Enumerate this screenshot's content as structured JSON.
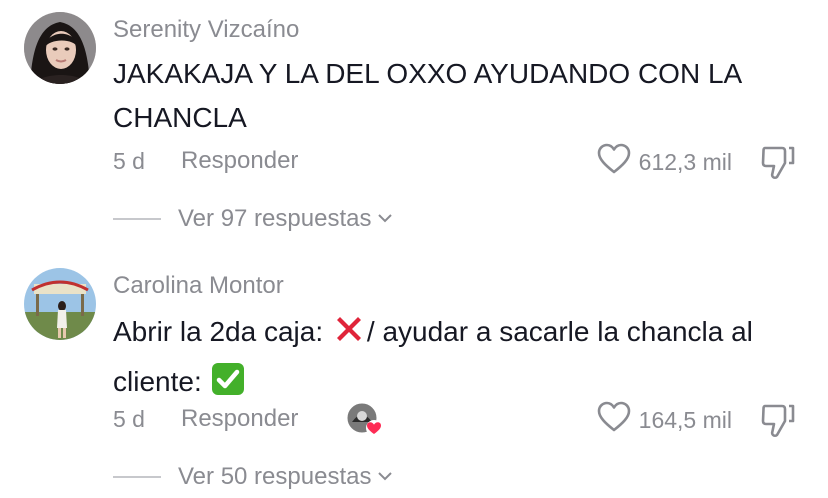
{
  "comments": [
    {
      "username": "Serenity Vizcaíno",
      "text": "JAKAKAJA Y LA DEL OXXO AYUDANDO CON LA CHANCLA",
      "time": "5 d",
      "reply_label": "Responder",
      "likes": "612,3 mil",
      "view_replies": "Ver 97 respuestas"
    },
    {
      "username": "Carolina Montor",
      "text_part1": "Abrir la 2da caja: ",
      "text_part2": "/ ayudar a sacarle la chancla al cliente: ",
      "time": "5 d",
      "reply_label": "Responder",
      "likes": "164,5 mil",
      "view_replies": "Ver 50 respuestas"
    }
  ],
  "icons": {
    "like": "heart-outline-icon",
    "dislike": "thumbs-down-icon",
    "expand": "chevron-down-icon",
    "cross": "cross-mark-emoji",
    "check": "check-mark-button-emoji",
    "creator_liked": "creator-liked-heart-badge"
  },
  "colors": {
    "text": "#161823",
    "muted": "#8a8b91",
    "cross": "#e0243a",
    "check": "#43b02a",
    "heart_badge": "#fe2c55"
  }
}
